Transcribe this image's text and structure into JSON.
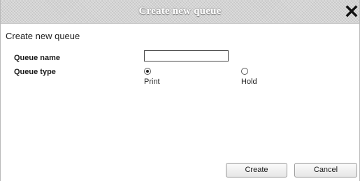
{
  "dialog": {
    "title": "Create new queue",
    "close_icon": "close-x-icon",
    "heading": "Create new queue"
  },
  "form": {
    "queue_name_label": "Queue name",
    "queue_name_value": "",
    "queue_type_label": "Queue type",
    "queue_type_options": [
      {
        "label": "Print",
        "selected": true
      },
      {
        "label": "Hold",
        "selected": false
      }
    ]
  },
  "buttons": {
    "create_label": "Create",
    "cancel_label": "Cancel"
  }
}
